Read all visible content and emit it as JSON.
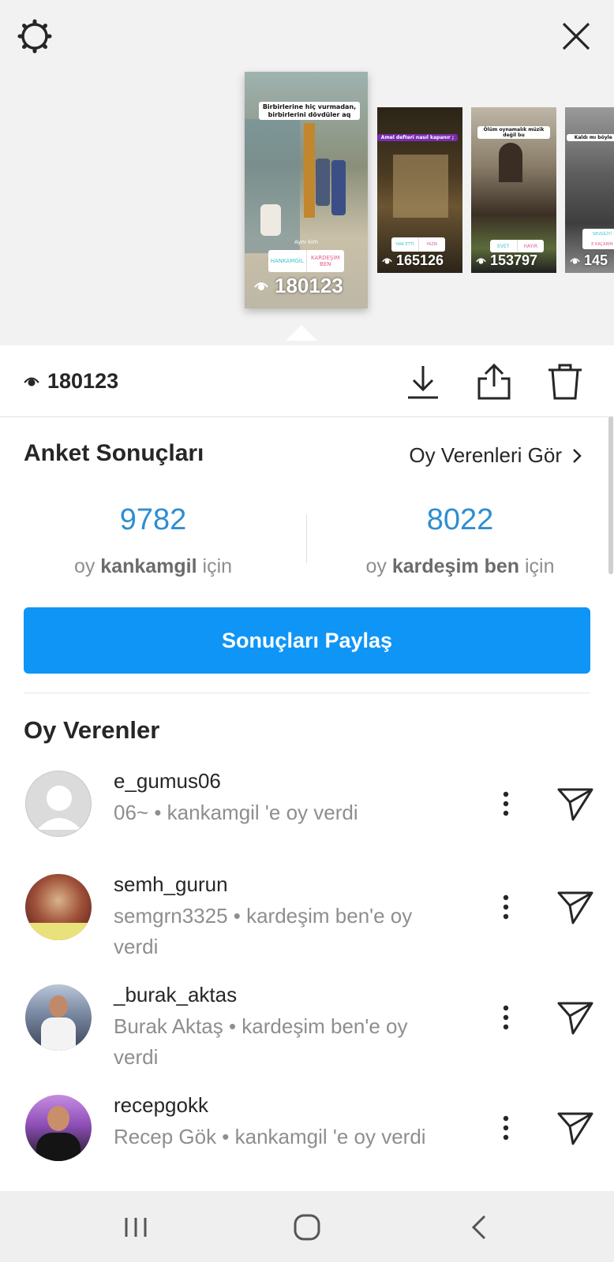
{
  "stories": [
    {
      "caption": "Birbirlerine hiç vurmadan, birbirlerini dövdüler aq",
      "subtitle": "Aynı kim",
      "poll": [
        "HANKAMGİL",
        "KARDEŞİM BEN"
      ],
      "views": "180123"
    },
    {
      "caption": "Amel defteri nasıl kapanır ;",
      "poll": [
        "HAK ETTİ",
        "YAZIK"
      ],
      "views": "165126"
    },
    {
      "caption": "Ölüm oynamalık müzik değil bu",
      "poll": [
        "EVET",
        "HAYIR"
      ],
      "views": "153797"
    },
    {
      "caption": "Kaldı mı böyle del",
      "poll": [
        "SEVGİLİYİ",
        "E KAÇARIM"
      ],
      "views": "145"
    }
  ],
  "toolbar": {
    "views": "180123"
  },
  "icons": {
    "settings": "gear-icon",
    "close": "close-icon",
    "views": "eye-icon",
    "download": "download-icon",
    "share": "share-icon",
    "delete": "trash-icon",
    "chevron": "chevron-right-icon",
    "more": "more-vertical-icon",
    "send": "send-icon"
  },
  "poll": {
    "title": "Anket Sonuçları",
    "see_voters": "Oy Verenleri Gör",
    "option_a": {
      "count": "9782",
      "prefix": "oy",
      "name": "kankamgil",
      "suffix": "için"
    },
    "option_b": {
      "count": "8022",
      "prefix": "oy",
      "name": "kardeşim ben",
      "suffix": "için"
    },
    "share_button": "Sonuçları Paylaş"
  },
  "voters_title": "Oy Verenler",
  "voters": [
    {
      "username": "e_gumus06",
      "detail": "06~ • kankamgil 'e oy verdi"
    },
    {
      "username": "semh_gurun",
      "detail": "semgrn3325 • kardeşim ben'e oy verdi"
    },
    {
      "username": "_burak_aktas",
      "detail": "Burak Aktaş • kardeşim ben'e oy verdi"
    },
    {
      "username": "recepgokk",
      "detail": "Recep Gök • kankamgil 'e oy verdi"
    }
  ],
  "colors": {
    "accent": "#0f95f6",
    "count": "#2d8ed1",
    "muted": "#8e8e8e",
    "text": "#262626"
  }
}
